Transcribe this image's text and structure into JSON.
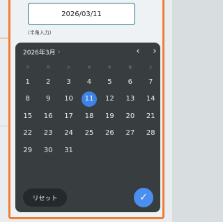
{
  "date_field": {
    "value": "2026/03/11",
    "hint": "(半角入力)"
  },
  "picker": {
    "month_label": "2026年3月",
    "month_chevron": "›",
    "prev_icon": "‹",
    "next_icon": "›",
    "weekdays": [
      "日",
      "月",
      "火",
      "水",
      "木",
      "金",
      "土"
    ],
    "weeks": [
      [
        "1",
        "2",
        "3",
        "4",
        "5",
        "6",
        "7"
      ],
      [
        "8",
        "9",
        "10",
        "11",
        "12",
        "13",
        "14"
      ],
      [
        "15",
        "16",
        "17",
        "18",
        "19",
        "20",
        "21"
      ],
      [
        "22",
        "23",
        "24",
        "25",
        "26",
        "27",
        "28"
      ],
      [
        "29",
        "30",
        "31",
        "",
        "",
        "",
        ""
      ]
    ],
    "selected_day": "11",
    "reset_label": "リセット",
    "confirm_icon": "✓"
  },
  "colors": {
    "accent": "#3d82e6",
    "frame": "#ef7d35",
    "field_border": "#1f7a8c",
    "panel": "#303638"
  }
}
